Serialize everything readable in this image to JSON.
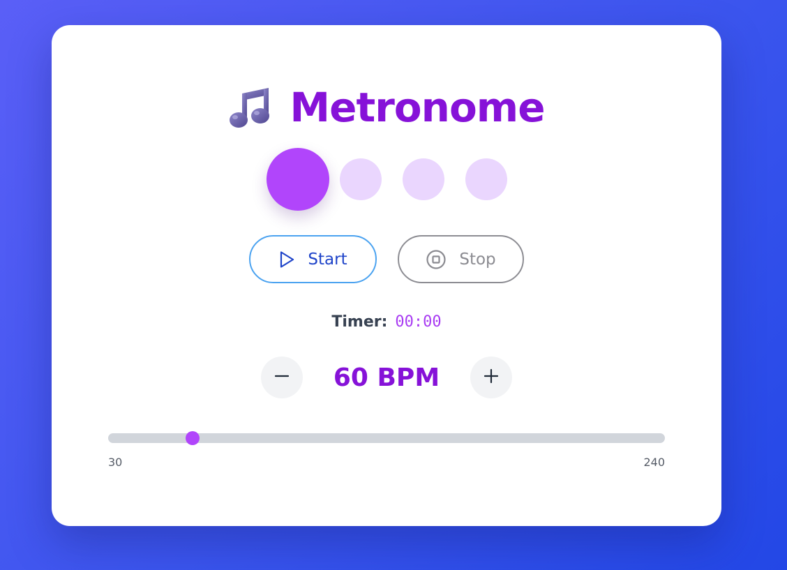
{
  "app": {
    "title": "Metronome",
    "title_icon": "music-note-icon"
  },
  "beats": {
    "count": 4,
    "active_index": 0,
    "active_color": "#b145fb",
    "inactive_color": "#ead6fe"
  },
  "controls": {
    "start_label": "Start",
    "start_icon": "play-icon",
    "stop_label": "Stop",
    "stop_icon": "stop-circle-icon"
  },
  "timer": {
    "label": "Timer:",
    "value": "00:00"
  },
  "tempo": {
    "display": "60 BPM",
    "value": 60,
    "min": 30,
    "max": 240,
    "min_label": "30",
    "max_label": "240",
    "decrement_icon": "minus-icon",
    "increment_icon": "plus-icon"
  },
  "colors": {
    "accent": "#8612d8",
    "thumb": "#b145fb",
    "start_border": "#4aa2f0",
    "start_text": "#1f44c9",
    "stop_border": "#8c8c92",
    "background_from": "#5a5ff7",
    "background_to": "#2347e6"
  }
}
